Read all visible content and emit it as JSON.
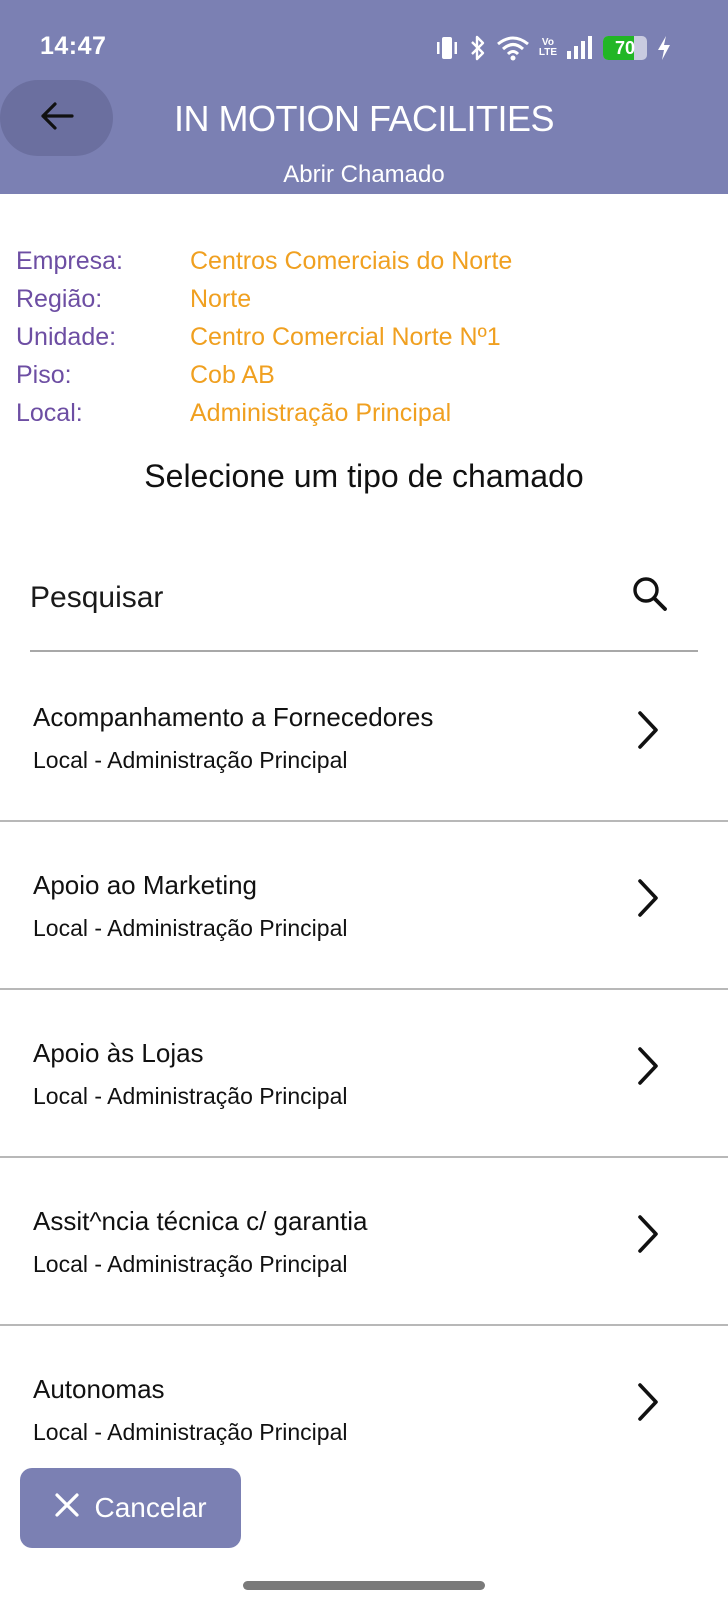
{
  "status_bar": {
    "time": "14:47",
    "network_label_top": "Vo",
    "network_label_bottom": "LTE",
    "battery_level": "70",
    "battery_fraction": 0.7
  },
  "header": {
    "title": "IN MOTION FACILITIES",
    "subtitle": "Abrir Chamado",
    "background_color": "#7b80b3"
  },
  "info": {
    "rows": [
      {
        "label": "Empresa:",
        "value": "Centros Comerciais do Norte"
      },
      {
        "label": "Região:",
        "value": "Norte"
      },
      {
        "label": "Unidade:",
        "value": "Centro Comercial Norte Nº1"
      },
      {
        "label": "Piso:",
        "value": "Cob AB"
      },
      {
        "label": "Local:",
        "value": "Administração Principal"
      }
    ],
    "label_color": "#6d4ea3",
    "value_color": "#f0a020"
  },
  "section_title": "Selecione um tipo de chamado",
  "search": {
    "placeholder": "Pesquisar",
    "icon": "search-icon"
  },
  "list": {
    "items": [
      {
        "title": "Acompanhamento a Fornecedores",
        "subtitle": "Local - Administração Principal"
      },
      {
        "title": "Apoio ao Marketing",
        "subtitle": "Local - Administração Principal"
      },
      {
        "title": "Apoio às Lojas",
        "subtitle": "Local - Administração Principal"
      },
      {
        "title": "Assit^ncia técnica c/ garantia",
        "subtitle": "Local - Administração Principal"
      },
      {
        "title": "Autonomas",
        "subtitle": "Local - Administração Principal"
      }
    ],
    "item_icon": "chevron-right-icon"
  },
  "cancel_button": {
    "label": "Cancelar",
    "icon": "close-icon"
  }
}
